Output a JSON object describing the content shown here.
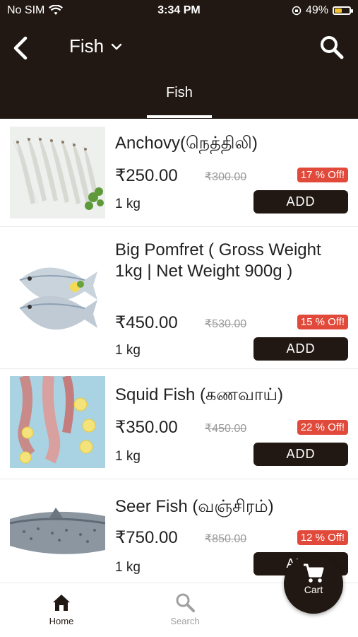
{
  "status_bar": {
    "carrier": "No SIM",
    "time": "3:34 PM",
    "battery": "49%",
    "battery_level": 0.49
  },
  "header": {
    "title": "Fish",
    "tab": "Fish"
  },
  "products": [
    {
      "name": "Anchovy(நெத்திலி)",
      "price": "₹250.00",
      "mrp": "₹300.00",
      "discount": "17 % Off!",
      "qty": "1 kg",
      "add_label": "ADD"
    },
    {
      "name": "Big Pomfret (  Gross Weight 1kg | Net Weight 900g )",
      "price": "₹450.00",
      "mrp": "₹530.00",
      "discount": "15 % Off!",
      "qty": "1 kg",
      "add_label": "ADD"
    },
    {
      "name": "Squid Fish (கணவாய்)",
      "price": "₹350.00",
      "mrp": "₹450.00",
      "discount": "22 % Off!",
      "qty": "1 kg",
      "add_label": "ADD"
    },
    {
      "name": "Seer Fish (வஞ்சிரம்)",
      "price": "₹750.00",
      "mrp": "₹850.00",
      "discount": "12 % Off!",
      "qty": "1 kg",
      "add_label": "ADD"
    }
  ],
  "bottom_nav": {
    "home": "Home",
    "search": "Search",
    "cart": "Cart"
  },
  "colors": {
    "primary": "#221813",
    "discount": "#e14a3b"
  }
}
